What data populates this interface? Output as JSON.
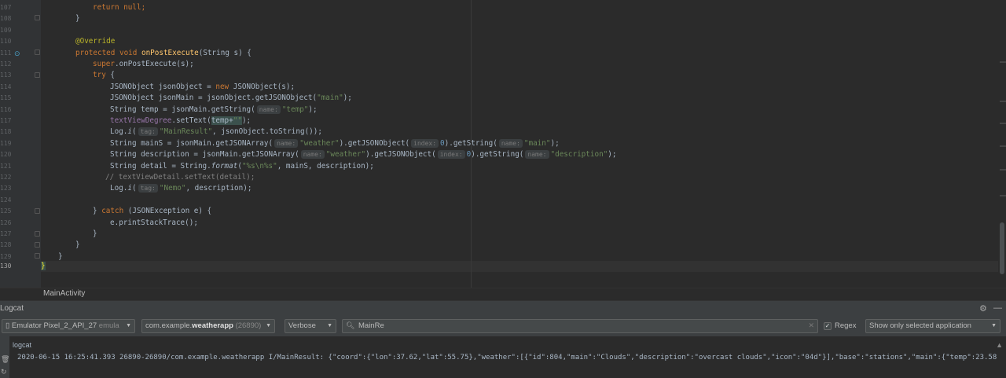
{
  "editor": {
    "lines": [
      {
        "num": "107"
      },
      {
        "num": "108"
      },
      {
        "num": "109"
      },
      {
        "num": "110"
      },
      {
        "num": "111"
      },
      {
        "num": "112"
      },
      {
        "num": "113"
      },
      {
        "num": "114"
      },
      {
        "num": "115"
      },
      {
        "num": "116"
      },
      {
        "num": "117"
      },
      {
        "num": "118"
      },
      {
        "num": "119"
      },
      {
        "num": "120"
      },
      {
        "num": "121"
      },
      {
        "num": "122"
      },
      {
        "num": "123"
      },
      {
        "num": "124"
      },
      {
        "num": "125"
      },
      {
        "num": "126"
      },
      {
        "num": "127"
      },
      {
        "num": "128"
      },
      {
        "num": "129"
      },
      {
        "num": "130"
      }
    ],
    "code": {
      "l107": {
        "kw": "return",
        "rest": " ",
        "null": "null",
        "end": ";"
      },
      "l108": {
        "text": "}"
      },
      "l110": {
        "ann": "@Override"
      },
      "l111": {
        "mod": "protected void ",
        "fn": "onPostExecute",
        "rest": "(String s) {"
      },
      "l112": {
        "sup": "super",
        "rest": ".onPostExecute(s);"
      },
      "l113": {
        "kw": "try",
        "rest": " {"
      },
      "l114": {
        "a": "JSONObject jsonObject = ",
        "kw": "new",
        "b": " JSONObject(s);"
      },
      "l115": {
        "a": "JSONObject jsonMain = jsonObject.getJSONObject(",
        "str": "\"main\"",
        "b": ");"
      },
      "l116": {
        "a": "String temp = jsonMain.getString(",
        "hint": "name:",
        "str": "\"temp\"",
        "b": ");"
      },
      "l117": {
        "fld": "textViewDegree",
        "a": ".setText(",
        "hl": "temp+",
        "str": "\"\"",
        "b": ");"
      },
      "l118": {
        "a": "Log.",
        "it": "i",
        "b": "(",
        "hint": "tag:",
        "str": "\"MainResult\"",
        "c": ", jsonObject.toString());"
      },
      "l119": {
        "a": "String mainS = jsonMain.getJSONArray(",
        "hint1": "name:",
        "str1": "\"weather\"",
        "b": ").getJSONObject(",
        "hint2": "index:",
        "num": "0",
        "c": ").getString(",
        "hint3": "name:",
        "str2": "\"main\"",
        "d": ");"
      },
      "l120": {
        "a": "String description = jsonMain.getJSONArray(",
        "hint1": "name:",
        "str1": "\"weather\"",
        "b": ").getJSONObject(",
        "hint2": "index:",
        "num": "0",
        "c": ").getString(",
        "hint3": "name:",
        "str2": "\"description\"",
        "d": ");"
      },
      "l121": {
        "a": "String detail = String.",
        "it": "format",
        "b": "(",
        "str": "\"%s\\n%s\"",
        "c": ", mainS, description);"
      },
      "l122": {
        "cmt": "// textViewDetail.setText(detail);"
      },
      "l123": {
        "a": "Log.",
        "it": "i",
        "b": "(",
        "hint": "tag:",
        "str": "\"Nemo\"",
        "c": ", description);"
      },
      "l125": {
        "a": "} ",
        "kw": "catch",
        "b": " (JSONException e) {"
      },
      "l126": {
        "text": "e.printStackTrace();"
      },
      "l127": {
        "text": "}"
      },
      "l128": {
        "text": "}"
      },
      "l129": {
        "text": "}"
      },
      "l130": {
        "text": "}"
      }
    }
  },
  "breadcrumb": {
    "label": "MainActivity"
  },
  "logcat": {
    "title": "Logcat",
    "device": {
      "name": "Emulator Pixel_2_API_27",
      "suffix": "emula"
    },
    "process": {
      "prefix": "com.example.",
      "bold": "weatherapp",
      "pid": "(26890)"
    },
    "level": "Verbose",
    "search_value": "MainRe",
    "regex_label": "Regex",
    "regex_checked": "✓",
    "filter": "Show only selected application",
    "panel_label": "logcat",
    "log_line": "2020-06-15 16:25:41.393 26890-26890/com.example.weatherapp I/MainResult: {\"coord\":{\"lon\":37.62,\"lat\":55.75},\"weather\":[{\"id\":804,\"main\":\"Clouds\",\"description\":\"overcast clouds\",\"icon\":\"04d\"}],\"base\":\"stations\",\"main\":{\"temp\":23.58"
  },
  "icons": {
    "settings": "gear-icon",
    "minimize": "minimize-icon",
    "search": "search-icon",
    "clear": "clear-icon",
    "trash": "trash-icon",
    "scroll_up": "scroll-up-icon"
  }
}
